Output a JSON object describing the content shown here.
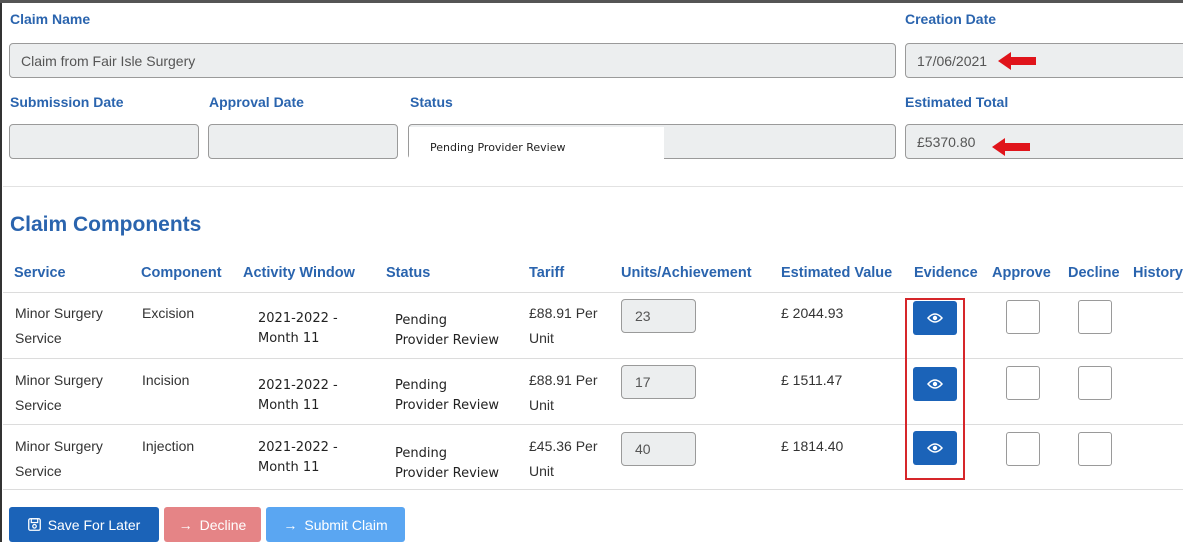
{
  "claim": {
    "name_label": "Claim Name",
    "name_value": "Claim from Fair Isle Surgery",
    "creation_date_label": "Creation Date",
    "creation_date_value": "17/06/2021",
    "submission_date_label": "Submission Date",
    "submission_date_value": "",
    "approval_date_label": "Approval Date",
    "approval_date_value": "",
    "status_label": "Status",
    "status_value": "Pending Provider Review",
    "estimated_total_label": "Estimated Total",
    "estimated_total_value": "£5370.80"
  },
  "components": {
    "title": "Claim Components",
    "headers": [
      "Service",
      "Component",
      "Activity Window",
      "Status",
      "Tariff",
      "Units/Achievement",
      "Estimated Value",
      "Evidence",
      "Approve",
      "Decline",
      "History"
    ],
    "rows": [
      {
        "service": [
          "Minor Surgery",
          "Service"
        ],
        "component": "Excision",
        "window": [
          "2021-2022 -",
          "Month 11"
        ],
        "status": [
          "Pending",
          "Provider Review"
        ],
        "tariff": [
          "£88.91 Per",
          "Unit"
        ],
        "units": "23",
        "value": "£ 2044.93"
      },
      {
        "service": [
          "Minor Surgery",
          "Service"
        ],
        "component": "Incision",
        "window": [
          "2021-2022 -",
          "Month 11"
        ],
        "status": [
          "Pending",
          "Provider Review"
        ],
        "tariff": [
          "£88.91 Per",
          "Unit"
        ],
        "units": "17",
        "value": "£ 1511.47"
      },
      {
        "service": [
          "Minor Surgery",
          "Service"
        ],
        "component": "Injection",
        "window": [
          "2021-2022 -",
          "Month 11"
        ],
        "status": [
          "Pending",
          "Provider Review"
        ],
        "tariff": [
          "£45.36 Per",
          "Unit"
        ],
        "units": "40",
        "value": "£ 1814.40"
      }
    ]
  },
  "actions": {
    "save_label": "Save For Later",
    "decline_label": "Decline",
    "submit_label": "Submit Claim"
  },
  "colors": {
    "heading": "#2a64ae",
    "evidence_button": "#1b63b8",
    "save_button": "#1b63b8",
    "decline_button": "#e58486",
    "submit_button": "#5aa6f2",
    "annotation": "#e0141b"
  },
  "icons": {
    "evidence": "eye-icon",
    "save": "save-icon",
    "decline": "arrow-right-icon",
    "submit": "arrow-right-icon",
    "annotation": "red-arrow-icon"
  }
}
